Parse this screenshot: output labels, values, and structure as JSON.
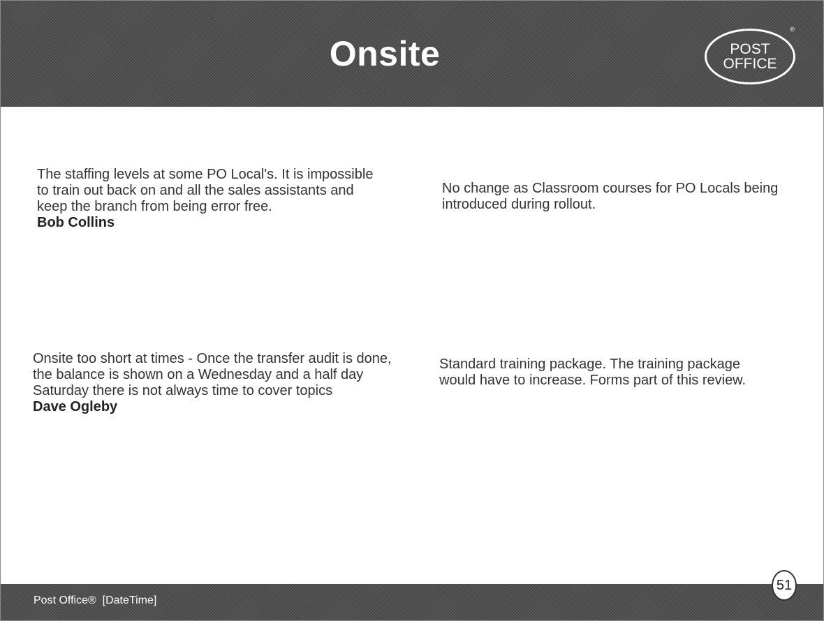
{
  "slide": {
    "title": "Onsite",
    "logo": {
      "line1": "POST",
      "line2": "OFFICE",
      "mark": "®"
    },
    "items": [
      {
        "comment": "The staffing levels at some PO Local's.  It is impossible to train out back on and all the sales assistants and keep the branch from being error free.",
        "author": "Bob Collins",
        "response": "No change as Classroom courses for PO Locals being introduced during rollout."
      },
      {
        "comment": "Onsite too short at times - Once the transfer audit is done, the balance is shown on a Wednesday and a half day Saturday there is not always time to cover topics",
        "author": "Dave Ogleby",
        "response": "Standard training package.  The training package would have to increase.  Forms part of this review."
      }
    ],
    "footer": "Post Office®  [DateTime]",
    "page_number": "51"
  }
}
